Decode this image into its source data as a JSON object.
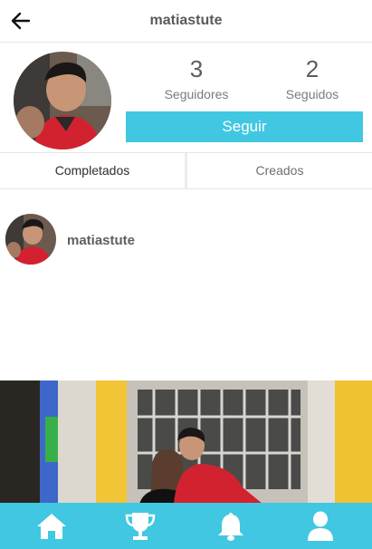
{
  "header": {
    "title": "matiastute"
  },
  "profile": {
    "followers": {
      "count": "3",
      "label": "Seguidores"
    },
    "following": {
      "count": "2",
      "label": "Seguidos"
    },
    "follow_button": "Seguir"
  },
  "tabs": [
    {
      "label": "Completados",
      "active": true
    },
    {
      "label": "Creados",
      "active": false
    }
  ],
  "list": [
    {
      "username": "matiastute"
    }
  ],
  "colors": {
    "accent": "#41c7e1"
  },
  "bottom_nav": [
    {
      "icon": "home-icon"
    },
    {
      "icon": "trophy-icon"
    },
    {
      "icon": "bell-icon"
    },
    {
      "icon": "user-icon"
    }
  ]
}
